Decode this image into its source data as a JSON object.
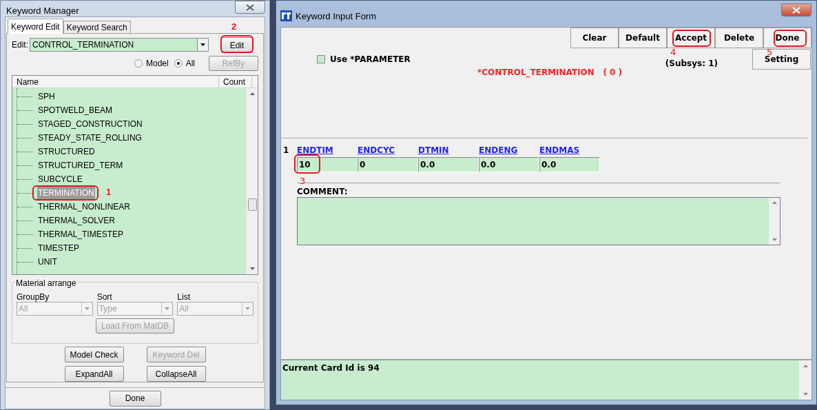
{
  "keyword_manager": {
    "title": "Keyword Manager",
    "tabs": [
      {
        "label": "Keyword Edit",
        "selected": true
      },
      {
        "label": "Keyword Search",
        "selected": false
      }
    ],
    "edit_field": {
      "label": "Edit:",
      "value": "CONTROL_TERMINATION"
    },
    "edit_button": {
      "label": "Edit",
      "disabled": false,
      "callout": "2"
    },
    "refby_button": {
      "label": "RefBy",
      "disabled": true
    },
    "scope_radios": [
      {
        "label": "Model",
        "selected": false
      },
      {
        "label": "All",
        "selected": true
      }
    ],
    "tree": {
      "columns": [
        "Name",
        "Count"
      ],
      "items": [
        {
          "label": "SPH",
          "selected": false
        },
        {
          "label": "SPOTWELD_BEAM",
          "selected": false
        },
        {
          "label": "STAGED_CONSTRUCTION",
          "selected": false
        },
        {
          "label": "STEADY_STATE_ROLLING",
          "selected": false
        },
        {
          "label": "STRUCTURED",
          "selected": false
        },
        {
          "label": "STRUCTURED_TERM",
          "selected": false
        },
        {
          "label": "SUBCYCLE",
          "selected": false
        },
        {
          "label": "TERMINATION",
          "selected": true,
          "callout": "1"
        },
        {
          "label": "THERMAL_NONLINEAR",
          "selected": false
        },
        {
          "label": "THERMAL_SOLVER",
          "selected": false
        },
        {
          "label": "THERMAL_TIMESTEP",
          "selected": false
        },
        {
          "label": "TIMESTEP",
          "selected": false
        },
        {
          "label": "UNIT",
          "selected": false
        }
      ]
    },
    "material_arrange": {
      "legend": "Material arrange",
      "selects": [
        {
          "label": "GroupBy",
          "value": "All",
          "disabled": true
        },
        {
          "label": "Sort",
          "value": "Type",
          "disabled": true
        },
        {
          "label": "List",
          "value": "All",
          "disabled": true
        }
      ],
      "load_button": {
        "label": "Load From MatDB",
        "disabled": true
      }
    },
    "buttons": [
      {
        "label": "Model Check",
        "disabled": false
      },
      {
        "label": "Keyword Del",
        "disabled": true
      },
      {
        "label": "ExpandAll",
        "disabled": false
      },
      {
        "label": "CollapseAll",
        "disabled": false
      }
    ],
    "done_button": {
      "label": "Done",
      "disabled": false
    }
  },
  "keyword_input_form": {
    "title": "Keyword Input Form",
    "toolbar": [
      {
        "label": "Clear"
      },
      {
        "label": "Default"
      },
      {
        "label": "Accept",
        "callout": "4"
      },
      {
        "label": "Delete"
      },
      {
        "label": "Done",
        "callout": "5"
      }
    ],
    "use_parameter": {
      "label": "Use *PARAMETER",
      "checked": false
    },
    "subsys": "(Subsys: 1)",
    "setting_button": "Setting",
    "keyword_heading": "*CONTROL_TERMINATION   ( 0 )",
    "card": {
      "number": "1",
      "fields": [
        {
          "name": "ENDTIM",
          "value": "10",
          "callout": "3"
        },
        {
          "name": "ENDCYC",
          "value": "0"
        },
        {
          "name": "DTMIN",
          "value": "0.0"
        },
        {
          "name": "ENDENG",
          "value": "0.0"
        },
        {
          "name": "ENDMAS",
          "value": "0.0"
        }
      ]
    },
    "comment_label": "COMMENT:",
    "status": "Current Card Id is 94"
  }
}
